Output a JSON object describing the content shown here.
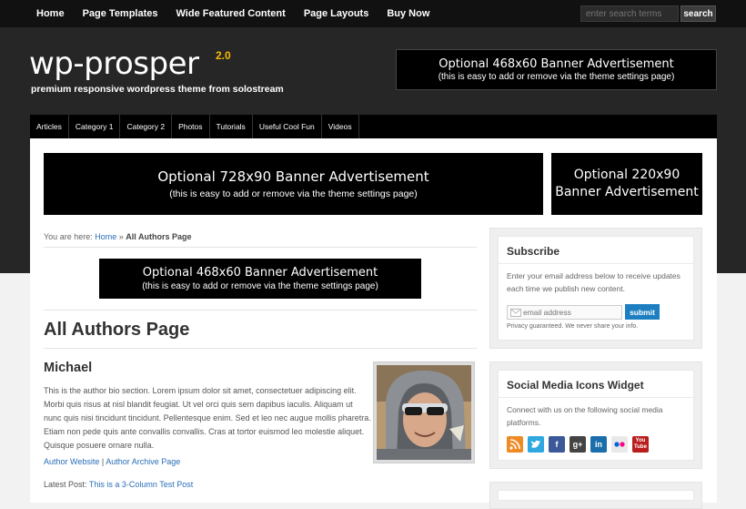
{
  "topnav": [
    "Home",
    "Page Templates",
    "Wide Featured Content",
    "Page Layouts",
    "Buy Now"
  ],
  "search": {
    "placeholder": "enter search terms",
    "button": "search"
  },
  "logo": {
    "text": "wp-prosper",
    "version": "2.0",
    "tagline": "premium responsive wordpress theme from solostream"
  },
  "header_ad": {
    "line1": "Optional 468x60 Banner Advertisement",
    "line2": "(this is easy to add or remove via the theme settings page)"
  },
  "catnav": [
    "Articles",
    "Category 1",
    "Category 2",
    "Photos",
    "Tutorials",
    "Useful Cool Fun",
    "Videos"
  ],
  "ad_728": {
    "line1": "Optional 728x90 Banner Advertisement",
    "line2": "(this is easy to add or remove via the theme settings page)"
  },
  "ad_220": {
    "line1": "Optional 220x90",
    "line2": "Banner Advertisement"
  },
  "breadcrumb": {
    "prefix": "You are here:",
    "home": "Home",
    "sep": "»",
    "current": "All Authors Page"
  },
  "content_ad": {
    "line1": "Optional 468x60 Banner Advertisement",
    "line2": "(this is easy to add or remove via the theme settings page)"
  },
  "page_title": "All Authors Page",
  "author": {
    "name": "Michael",
    "bio": "This is the author bio section. Lorem ipsum dolor sit amet, consectetuer adipiscing elit. Morbi quis risus at nisl blandit feugiat. Ut vel orci quis sem dapibus iaculis. Aliquam ut nunc quis nisi tincidunt tincidunt. Pellentesque enim. Sed et leo nec augue mollis pharetra. Etiam non pede quis ante convallis convallis. Cras at tortor euismod leo molestie aliquet. Quisque posuere ornare nulla.",
    "website": "Author Website",
    "link_sep": "|",
    "archive": "Author Archive Page",
    "latest_label": "Latest Post:",
    "latest_post": "This is a 3-Column Test Post"
  },
  "subscribe": {
    "title": "Subscribe",
    "text": "Enter your email address below to receive updates each time we publish new content.",
    "placeholder": "email address",
    "button": "submit",
    "privacy": "Privacy guaranteed. We never share your info."
  },
  "social": {
    "title": "Social Media Icons Widget",
    "text": "Connect with us on the following social media platforms.",
    "icons": [
      {
        "name": "rss-icon",
        "glyph": "",
        "color": "#f08a24"
      },
      {
        "name": "twitter-icon",
        "glyph": "",
        "color": "#2fa8e0"
      },
      {
        "name": "facebook-icon",
        "glyph": "f",
        "color": "#3b5998"
      },
      {
        "name": "google-plus-icon",
        "glyph": "g+",
        "color": "#444444"
      },
      {
        "name": "linkedin-icon",
        "glyph": "in",
        "color": "#1b6eac"
      },
      {
        "name": "flickr-icon",
        "glyph": "",
        "color": "#e9e9e9"
      },
      {
        "name": "youtube-icon",
        "glyph": "You Tube",
        "color": "#b91d1d"
      }
    ]
  }
}
